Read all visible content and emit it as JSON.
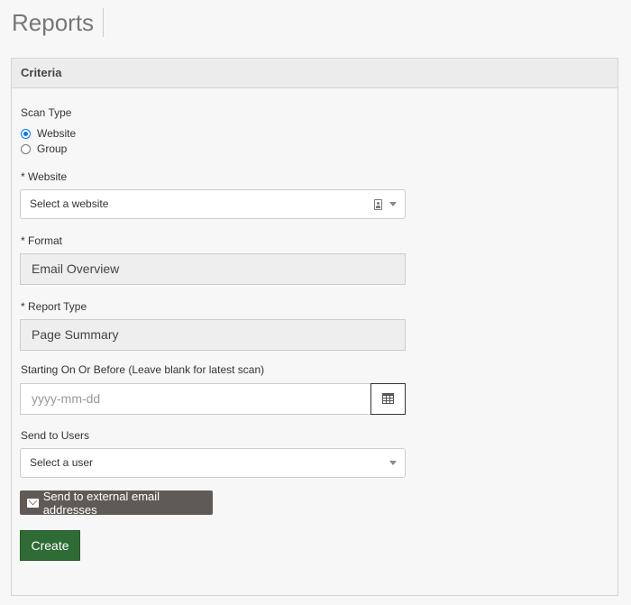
{
  "page": {
    "title": "Reports"
  },
  "panel": {
    "header": "Criteria"
  },
  "scan_type": {
    "label": "Scan Type",
    "options": [
      {
        "label": "Website",
        "checked": true
      },
      {
        "label": "Group",
        "checked": false
      }
    ]
  },
  "website": {
    "label": "* Website",
    "placeholder": "Select a website",
    "icon": "contact-card-icon"
  },
  "format": {
    "label": "* Format",
    "value": "Email Overview"
  },
  "report_type": {
    "label": "* Report Type",
    "value": "Page Summary"
  },
  "starting_on": {
    "label": "Starting On Or Before (Leave blank for latest scan)",
    "placeholder": "yyyy-mm-dd",
    "icon": "calendar-icon"
  },
  "send_to_users": {
    "label": "Send to Users",
    "placeholder": "Select a user"
  },
  "external_button": {
    "label": "Send to external email addresses",
    "icon": "envelope-icon",
    "color": "#5f5a55"
  },
  "create_button": {
    "label": "Create",
    "color": "#2e6b35"
  }
}
